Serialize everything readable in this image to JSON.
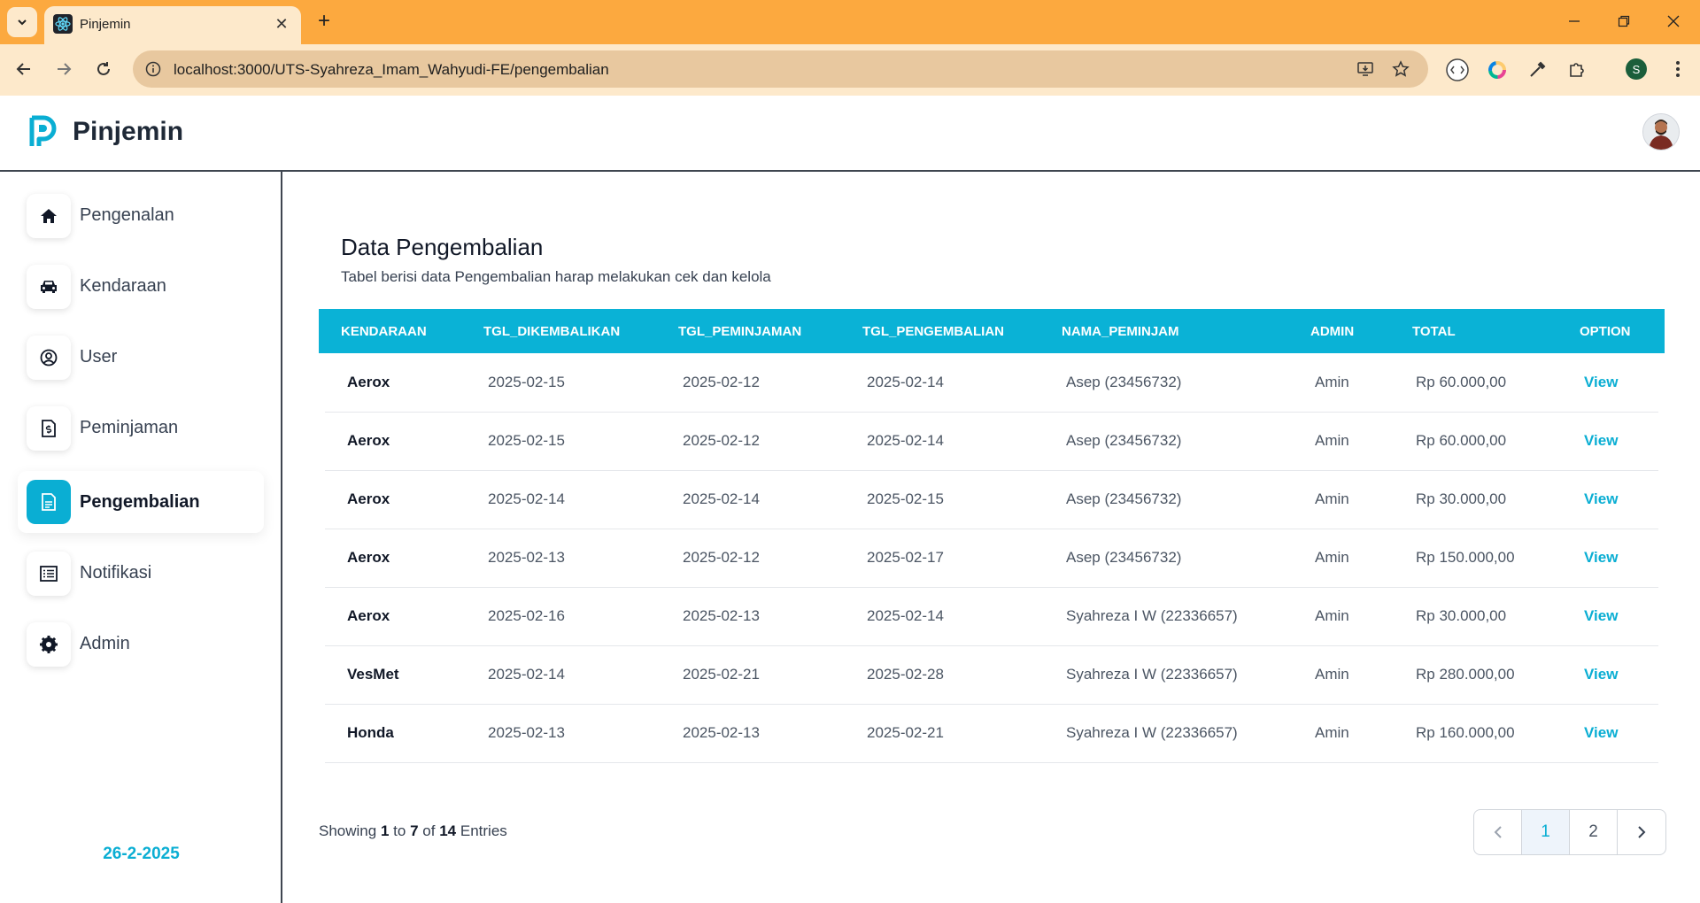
{
  "browser": {
    "tab_title": "Pinjemin",
    "tab_close": "✕",
    "new_tab": "+",
    "url": "localhost:3000/UTS-Syahreza_Imam_Wahyudi-FE/pengembalian",
    "profile_initial": "S"
  },
  "app": {
    "brand": "Pinjemin",
    "brand_color": "#0aaed3"
  },
  "sidebar": {
    "items": [
      {
        "label": "Pengenalan",
        "icon": "home-icon"
      },
      {
        "label": "Kendaraan",
        "icon": "car-icon"
      },
      {
        "label": "User",
        "icon": "user-circle-icon"
      },
      {
        "label": "Peminjaman",
        "icon": "document-money-icon"
      },
      {
        "label": "Pengembalian",
        "icon": "document-icon",
        "active": true
      },
      {
        "label": "Notifikasi",
        "icon": "list-icon"
      },
      {
        "label": "Admin",
        "icon": "gear-icon"
      }
    ],
    "date": "26-2-2025"
  },
  "main": {
    "title": "Data Pengembalian",
    "subtitle": "Tabel berisi data Pengembalian harap melakukan cek dan kelola",
    "columns": [
      "KENDARAAN",
      "TGL_DIKEMBALIKAN",
      "TGL_PEMINJAMAN",
      "TGL_PENGEMBALIAN",
      "NAMA_PEMINJAM",
      "ADMIN",
      "TOTAL",
      "OPTION"
    ],
    "rows": [
      {
        "kendaraan": "Aerox",
        "tgl_dikembalikan": "2025-02-15",
        "tgl_peminjaman": "2025-02-12",
        "tgl_pengembalian": "2025-02-14",
        "nama_peminjam": "Asep (23456732)",
        "admin": "Amin",
        "total": "Rp 60.000,00",
        "option": "View"
      },
      {
        "kendaraan": "Aerox",
        "tgl_dikembalikan": "2025-02-15",
        "tgl_peminjaman": "2025-02-12",
        "tgl_pengembalian": "2025-02-14",
        "nama_peminjam": "Asep (23456732)",
        "admin": "Amin",
        "total": "Rp 60.000,00",
        "option": "View"
      },
      {
        "kendaraan": "Aerox",
        "tgl_dikembalikan": "2025-02-14",
        "tgl_peminjaman": "2025-02-14",
        "tgl_pengembalian": "2025-02-15",
        "nama_peminjam": "Asep (23456732)",
        "admin": "Amin",
        "total": "Rp 30.000,00",
        "option": "View"
      },
      {
        "kendaraan": "Aerox",
        "tgl_dikembalikan": "2025-02-13",
        "tgl_peminjaman": "2025-02-12",
        "tgl_pengembalian": "2025-02-17",
        "nama_peminjam": "Asep (23456732)",
        "admin": "Amin",
        "total": "Rp 150.000,00",
        "option": "View"
      },
      {
        "kendaraan": "Aerox",
        "tgl_dikembalikan": "2025-02-16",
        "tgl_peminjaman": "2025-02-13",
        "tgl_pengembalian": "2025-02-14",
        "nama_peminjam": "Syahreza I W (22336657)",
        "admin": "Amin",
        "total": "Rp 30.000,00",
        "option": "View"
      },
      {
        "kendaraan": "VesMet",
        "tgl_dikembalikan": "2025-02-14",
        "tgl_peminjaman": "2025-02-21",
        "tgl_pengembalian": "2025-02-28",
        "nama_peminjam": "Syahreza I W (22336657)",
        "admin": "Amin",
        "total": "Rp 280.000,00",
        "option": "View"
      },
      {
        "kendaraan": "Honda",
        "tgl_dikembalikan": "2025-02-13",
        "tgl_peminjaman": "2025-02-13",
        "tgl_pengembalian": "2025-02-21",
        "nama_peminjam": "Syahreza I W (22336657)",
        "admin": "Amin",
        "total": "Rp 160.000,00",
        "option": "View"
      }
    ],
    "footer": {
      "showing_prefix": "Showing",
      "from": "1",
      "to_word": "to",
      "to": "7",
      "of_word": "of",
      "total": "14",
      "entries_word": "Entries"
    },
    "pagination": {
      "pages": [
        "1",
        "2"
      ],
      "current": "1"
    }
  }
}
